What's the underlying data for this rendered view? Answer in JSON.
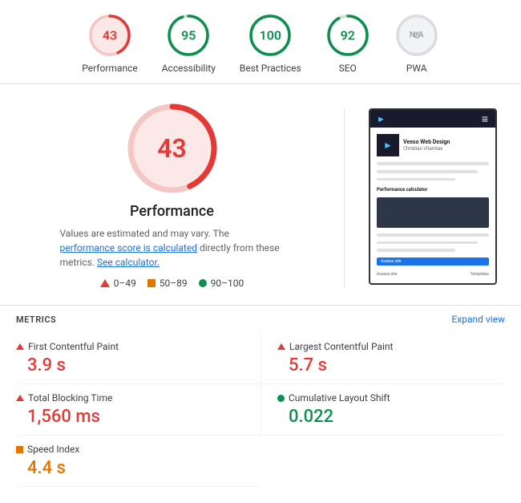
{
  "scores": [
    {
      "id": "performance",
      "label": "Performance",
      "value": "43",
      "color": "red",
      "stroke": "#e53935",
      "bg": "#fce8e6",
      "radius": 24,
      "circumference": 150.8,
      "dashoffset": 85.9
    },
    {
      "id": "accessibility",
      "label": "Accessibility",
      "value": "95",
      "color": "green",
      "stroke": "#0d904f",
      "bg": "#e6f4ea",
      "radius": 24,
      "circumference": 150.8,
      "dashoffset": 7.5
    },
    {
      "id": "best-practices",
      "label": "Best Practices",
      "value": "100",
      "color": "green",
      "stroke": "#0d904f",
      "bg": "#e6f4ea",
      "radius": 24,
      "circumference": 150.8,
      "dashoffset": 0
    },
    {
      "id": "seo",
      "label": "SEO",
      "value": "92",
      "color": "green",
      "stroke": "#0d904f",
      "bg": "#e6f4ea",
      "radius": 24,
      "circumference": 150.8,
      "dashoffset": 12
    },
    {
      "id": "pwa",
      "label": "PWA",
      "value": "N/A",
      "color": "gray",
      "stroke": "#9aa0a6",
      "bg": "#f1f3f4",
      "radius": 24,
      "circumference": 150.8,
      "dashoffset": 150.8
    }
  ],
  "big_score": {
    "value": "43",
    "title": "Performance",
    "description_start": "Values are estimated and may vary. The ",
    "link1_text": "performance score is calculated",
    "description_mid": " directly from these metrics. ",
    "link2_text": "See calculator.",
    "link1_href": "#",
    "link2_href": "#"
  },
  "legend": [
    {
      "type": "triangle",
      "color": "red",
      "range": "0–49"
    },
    {
      "type": "square",
      "color": "orange",
      "range": "50–89"
    },
    {
      "type": "circle",
      "color": "green",
      "range": "90–100"
    }
  ],
  "screenshot": {
    "company": "Veeso Web Design",
    "person": "Christian Vitamtas",
    "section": "Performance calculator",
    "btn_label": "Assess site"
  },
  "metrics": {
    "title": "METRICS",
    "expand_label": "Expand view",
    "items": [
      {
        "id": "fcp",
        "name": "First Contentful Paint",
        "value": "3.9 s",
        "indicator": "red-triangle",
        "value_color": "red"
      },
      {
        "id": "lcp",
        "name": "Largest Contentful Paint",
        "value": "5.7 s",
        "indicator": "red-triangle",
        "value_color": "red"
      },
      {
        "id": "tbt",
        "name": "Total Blocking Time",
        "value": "1,560 ms",
        "indicator": "red-triangle",
        "value_color": "red"
      },
      {
        "id": "cls",
        "name": "Cumulative Layout Shift",
        "value": "0.022",
        "indicator": "green-dot",
        "value_color": "green"
      },
      {
        "id": "si",
        "name": "Speed Index",
        "value": "4.4 s",
        "indicator": "orange-square",
        "value_color": "orange"
      }
    ]
  }
}
